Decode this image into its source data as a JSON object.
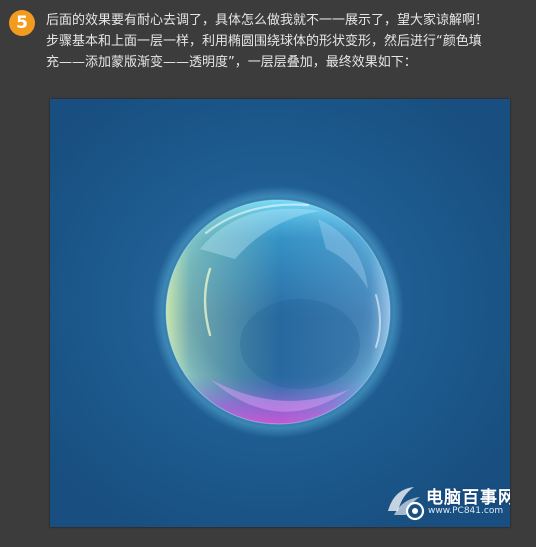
{
  "step": {
    "number": "5",
    "lines": [
      "后面的效果要有耐心去调了，具体怎么做我就不一一展示了，望大家谅解啊！",
      "步骤基本和上面一层一样，利用椭圆围绕球体的形状变形，然后进行“颜色填",
      "充——添加蒙版渐变——透明度”，一层层叠加，最终效果如下："
    ]
  },
  "colors": {
    "page_background": "#3c3c3c",
    "badge": "#f19b1f",
    "artwork_background": "#1d5a8e",
    "text": "#e6e6e6"
  },
  "artwork": {
    "subject": "bubble"
  },
  "watermark": {
    "brand": "电脑百事网",
    "url": "www.PC841.com"
  }
}
